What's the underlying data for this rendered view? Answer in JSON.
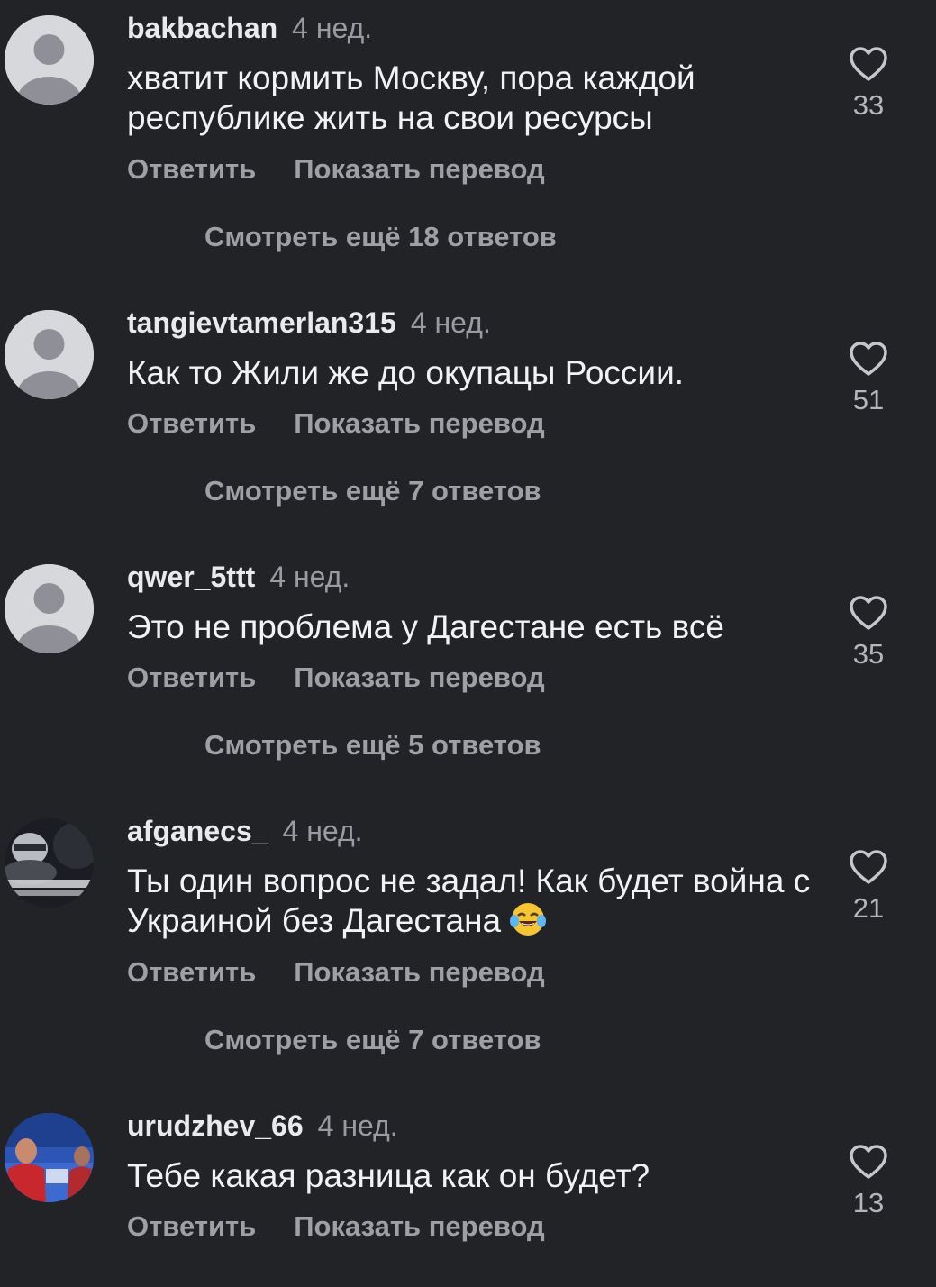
{
  "comments": [
    {
      "username": "bakbachan",
      "age": "4 нед.",
      "text": "хватит кормить Москву, пора каждой республике жить на свои ресурсы",
      "reply_label": "Ответить",
      "translate_label": "Показать перевод",
      "replies_label": "Смотреть ещё 18 ответов",
      "likes": "33",
      "avatar": "default-avatar"
    },
    {
      "username": "tangievtamerlan315",
      "age": "4 нед.",
      "text": "Как то Жили же до окупацы России.",
      "reply_label": "Ответить",
      "translate_label": "Показать перевод",
      "replies_label": "Смотреть ещё 7 ответов",
      "likes": "51",
      "avatar": "default-avatar"
    },
    {
      "username": "qwer_5ttt",
      "age": "4 нед.",
      "text": "Это не проблема у Дагестане есть всё",
      "reply_label": "Ответить",
      "translate_label": "Показать перевод",
      "replies_label": "Смотреть ещё 5 ответов",
      "likes": "35",
      "avatar": "default-avatar"
    },
    {
      "username": "afganecs_",
      "age": "4 нед.",
      "text": "Ты один вопрос не задал! Как будет война с Украиной без Дагестана",
      "text_emoji": "tears-of-joy",
      "reply_label": "Ответить",
      "translate_label": "Показать перевод",
      "replies_label": "Смотреть ещё 7 ответов",
      "likes": "21",
      "avatar": "photo-avatar-dark"
    },
    {
      "username": "urudzhev_66",
      "age": "4 нед.",
      "text": "Тебе какая разница как он будет?",
      "reply_label": "Ответить",
      "translate_label": "Показать перевод",
      "likes": "13",
      "avatar": "photo-avatar-fighter"
    }
  ],
  "icons": {
    "like": "heart-outline-icon"
  },
  "colors": {
    "background": "#222327",
    "primary_text": "#f1f2f5",
    "secondary_text": "#9fa0a6"
  }
}
